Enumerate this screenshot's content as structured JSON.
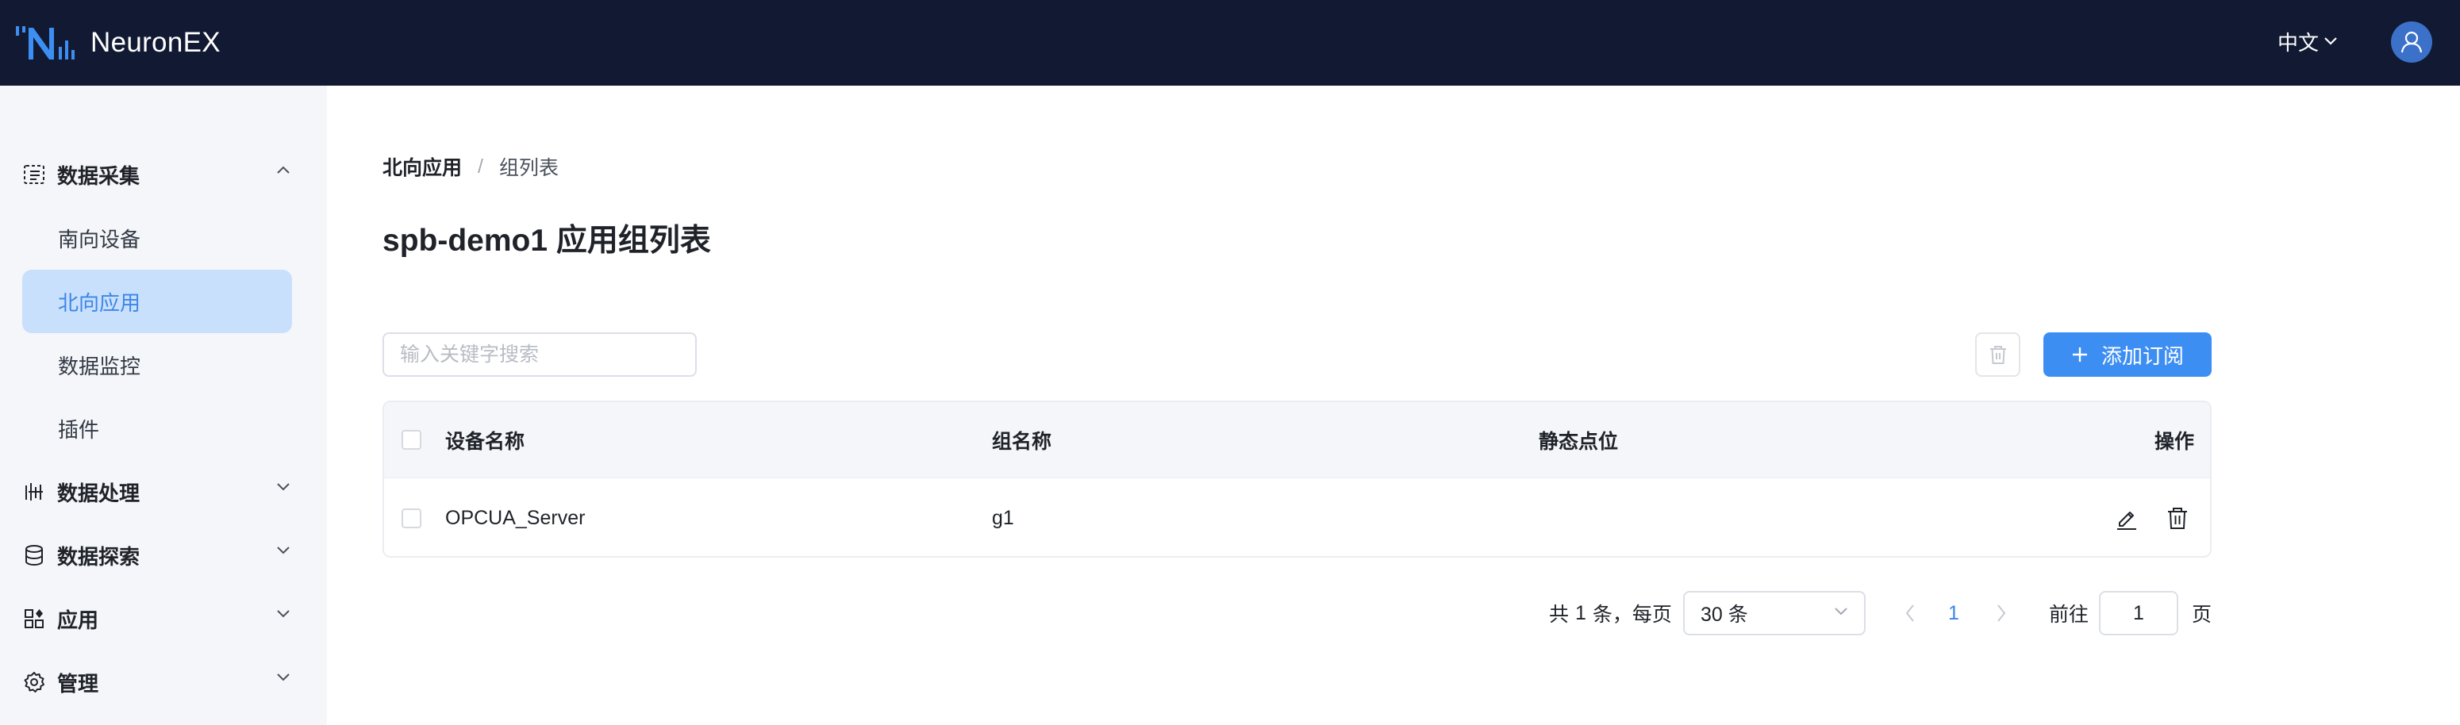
{
  "app": {
    "title": "NeuronEX"
  },
  "header": {
    "language": "中文",
    "avatar_icon": "user-icon"
  },
  "sidebar": {
    "groups": [
      {
        "label": "数据采集",
        "icon": "data-collection-icon",
        "expanded": true
      },
      {
        "label": "数据处理",
        "icon": "data-processing-icon",
        "expanded": false
      },
      {
        "label": "数据探索",
        "icon": "database-icon",
        "expanded": false
      },
      {
        "label": "应用",
        "icon": "apps-icon",
        "expanded": false
      },
      {
        "label": "管理",
        "icon": "gear-icon",
        "expanded": false
      }
    ],
    "items": [
      {
        "label": "南向设备",
        "active": false
      },
      {
        "label": "北向应用",
        "active": true
      },
      {
        "label": "数据监控",
        "active": false
      },
      {
        "label": "插件",
        "active": false
      }
    ]
  },
  "breadcrumb": {
    "parent": "北向应用",
    "separator": "/",
    "current": "组列表"
  },
  "page": {
    "title": "spb-demo1 应用组列表"
  },
  "toolbar": {
    "search_placeholder": "输入关键字搜索",
    "search_value": "",
    "add_label": "添加订阅"
  },
  "table": {
    "headers": [
      "设备名称",
      "组名称",
      "静态点位",
      "操作"
    ],
    "rows": [
      {
        "device": "OPCUA_Server",
        "group": "g1",
        "static_tags": ""
      }
    ]
  },
  "pagination": {
    "total_prefix": "共",
    "total": "1",
    "total_suffix": "条，每页",
    "page_size": "30 条",
    "current_page": "1",
    "goto_label": "前往",
    "goto_value": "1",
    "page_suffix": "页"
  },
  "colors": {
    "header_bg": "#121a33",
    "accent": "#3d8ef3",
    "active_bg": "#c8e0fc",
    "active_text": "#3d86e8",
    "sidebar_bg": "#f5f6f9"
  }
}
